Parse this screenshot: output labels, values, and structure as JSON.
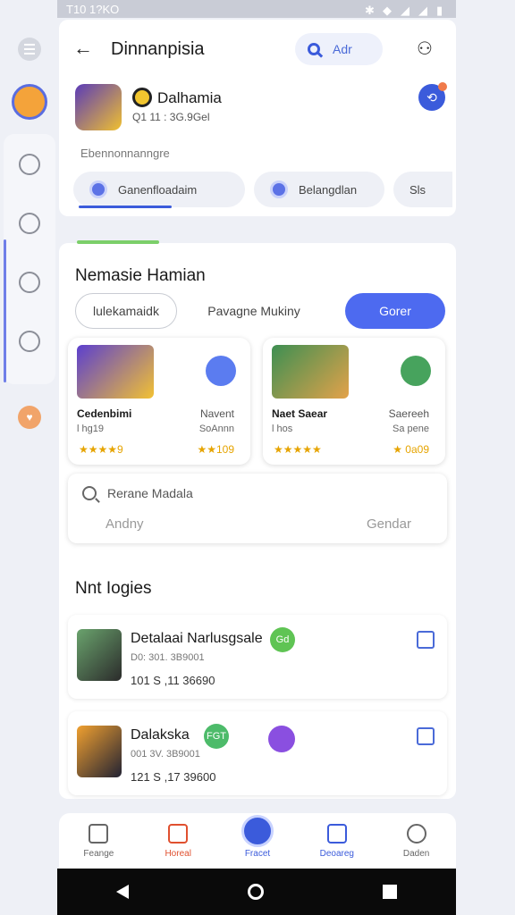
{
  "status": {
    "time": "T10 1?KO",
    "icons": [
      "bluetooth-icon",
      "wifi-icon",
      "signal-icon",
      "signal-icon",
      "battery-icon"
    ]
  },
  "header": {
    "title": "Dinnanpisia",
    "search_label": "Adr",
    "user_name": "Dalhamia",
    "user_meta": "Q1 11 : 3G.9Gel",
    "category_label": "Ebennonnanngre",
    "chips": [
      "Ganenfloadaim",
      "Belangdlan",
      "Sls"
    ]
  },
  "main": {
    "section_title": "Nemasie Hamian",
    "segments": [
      "lulekamaidk",
      "Pavagne Mukiny",
      "Gorer"
    ],
    "games": [
      {
        "name": "Cedenbimi",
        "sub": "l hg19",
        "tag": "Navent",
        "tag2": "SoAnnn",
        "stars": "★★★★9",
        "stars2": "★★109"
      },
      {
        "name": "Naet Saear",
        "sub": "l hos",
        "tag": "Saereeh",
        "tag2": "Sa pene",
        "stars": "★★★★★",
        "stars2": "★ 0a09"
      }
    ],
    "search_placeholder": "Rerane Madala",
    "search_left": "Andny",
    "search_right": "Gendar",
    "section2_title": "Nnt Iogies",
    "rows": [
      {
        "name": "Detalaai Narlusgsale",
        "tag": "Gd",
        "meta": "D0: 301. 3B9001",
        "num": "101 S ,11 36690"
      },
      {
        "name": "Dalakska",
        "tag": "FGT",
        "meta": "001 3V. 3B9001",
        "num": "121 S ,17 39600"
      }
    ]
  },
  "nav": {
    "items": [
      "Feange",
      "Horeal",
      "Fracet",
      "Deoareg",
      "Daden"
    ]
  }
}
